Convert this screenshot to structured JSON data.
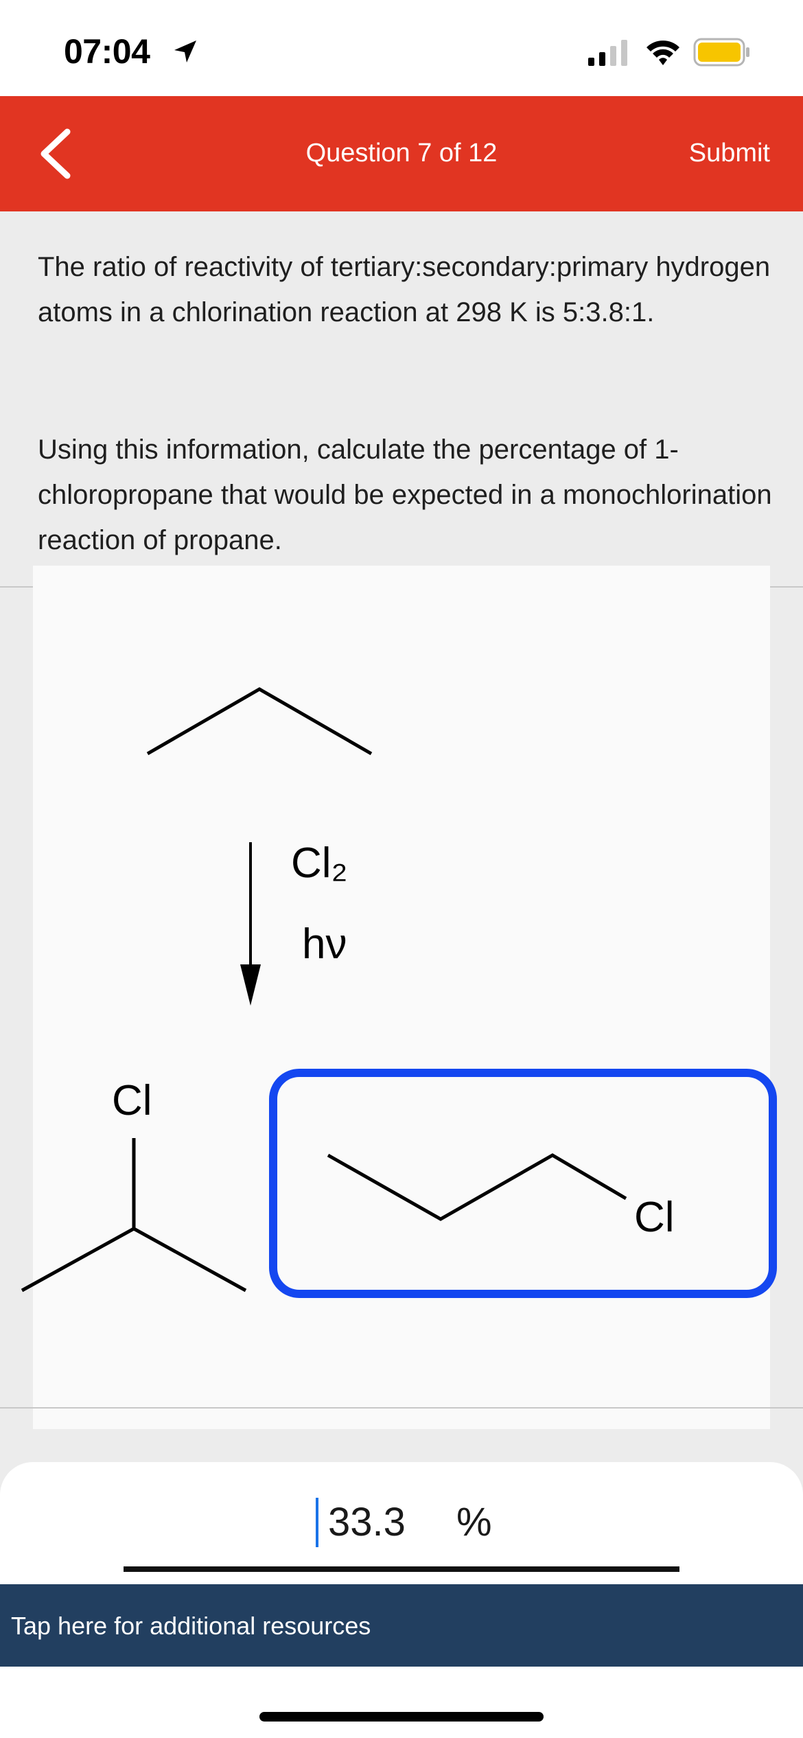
{
  "status": {
    "time": "07:04"
  },
  "nav": {
    "title": "Question 7 of 12",
    "submit_label": "Submit"
  },
  "question": {
    "paragraph1": "The ratio of reactivity of tertiary:secondary:primary hydrogen atoms in a chlorination reaction at 298 K is 5:3.8:1.",
    "paragraph2": "Using this information, calculate the percentage of 1-chloropropane that would be expected in a monochlorination reaction of propane."
  },
  "reaction": {
    "reagent": "Cl₂",
    "condition": "hν",
    "product_left_label": "Cl",
    "product_right_label": "Cl",
    "highlight_color": "#1447f0"
  },
  "answer": {
    "value": "33.3",
    "unit": "%"
  },
  "resources": {
    "label": "Tap here for additional resources"
  },
  "colors": {
    "nav": "#e13522",
    "resources": "#223f60",
    "caret": "#1a73e8"
  }
}
